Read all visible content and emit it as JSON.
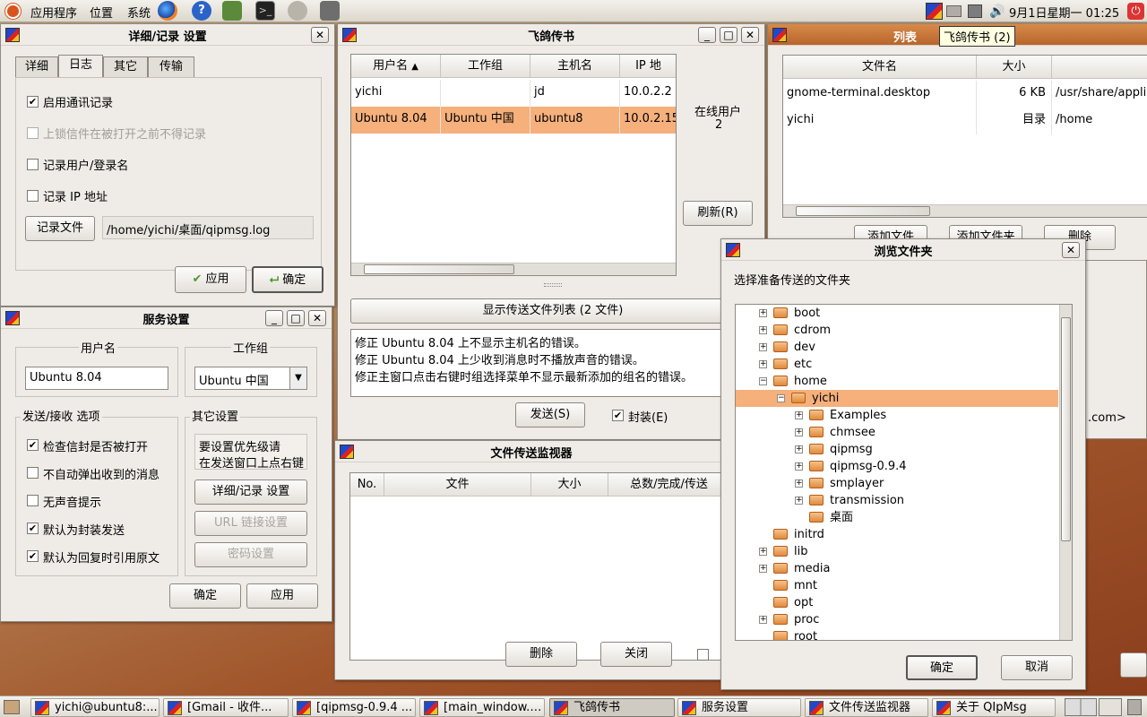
{
  "panel": {
    "menus": [
      "应用程序",
      "位置",
      "系统"
    ],
    "clock": "9月1日星期一 01:25",
    "tooltip": "飞鸽传书 (2)"
  },
  "details_window": {
    "title": "详细/记录 设置",
    "tabs": [
      "详细",
      "日志",
      "其它",
      "传输"
    ],
    "active_tab": "日志",
    "options": [
      {
        "label": "启用通讯记录",
        "checked": true,
        "enabled": true
      },
      {
        "label": "上锁信件在被打开之前不得记录",
        "checked": false,
        "enabled": false
      },
      {
        "label": "记录用户/登录名",
        "checked": false,
        "enabled": true
      },
      {
        "label": "记录 IP 地址",
        "checked": false,
        "enabled": true
      }
    ],
    "log_file_button": "记录文件",
    "log_file_path": "/home/yichi/桌面/qipmsg.log",
    "apply": "应用",
    "ok": "确定"
  },
  "service_window": {
    "title": "服务设置",
    "username_label": "用户名",
    "username_value": "Ubuntu 8.04",
    "workgroup_label": "工作组",
    "workgroup_value": "Ubuntu 中国",
    "send_recv_label": "发送/接收 选项",
    "send_options": [
      {
        "label": "检查信封是否被打开",
        "checked": true
      },
      {
        "label": "不自动弹出收到的消息",
        "checked": false
      },
      {
        "label": "无声音提示",
        "checked": false
      },
      {
        "label": "默认为封装发送",
        "checked": true
      },
      {
        "label": "默认为回复时引用原文",
        "checked": true
      }
    ],
    "other_label": "其它设置",
    "priority_hint": [
      "要设置优先级请",
      "在发送窗口上点右键"
    ],
    "details_button": "详细/记录 设置",
    "url_button": "URL 链接设置",
    "password_button": "密码设置",
    "ok": "确定",
    "apply": "应用"
  },
  "main_window": {
    "title": "飞鸽传书",
    "columns": [
      "用户名",
      "工作组",
      "主机名",
      "IP 地"
    ],
    "rows": [
      {
        "user": "yichi",
        "group": "",
        "host": "jd",
        "ip": "10.0.2.2",
        "selected": false
      },
      {
        "user": "Ubuntu 8.04",
        "group": "Ubuntu 中国",
        "host": "ubuntu8",
        "ip": "10.0.2.15",
        "selected": true
      }
    ],
    "online_label": "在线用户",
    "online_count": "2",
    "refresh": "刷新(R)",
    "show_files": "显示传送文件列表 (2 文件)",
    "message_lines": [
      "修正 Ubuntu 8.04 上不显示主机名的错误。",
      "修正 Ubuntu 8.04 上少收到消息时不播放声音的错误。",
      "修正主窗口点击右键时组选择菜单不显示最新添加的组名的错误。"
    ],
    "send": "发送(S)",
    "seal": "封装(E)",
    "seal_checked": true
  },
  "file_list_window": {
    "title": "列表",
    "columns": [
      "文件名",
      "大小",
      ""
    ],
    "rows": [
      {
        "name": "gnome-terminal.desktop",
        "size": "6 KB",
        "path": "/usr/share/applic"
      },
      {
        "name": "yichi",
        "size": "目录",
        "path": "/home"
      }
    ],
    "add_file": "添加文件",
    "add_folder": "添加文件夹",
    "delete": "删除",
    "partial_text": ".com>"
  },
  "monitor_window": {
    "title": "文件传送监视器",
    "columns": [
      "No.",
      "文件",
      "大小",
      "总数/完成/传送"
    ],
    "delete": "删除",
    "close": "关闭"
  },
  "browse_dialog": {
    "title": "浏览文件夹",
    "prompt": "选择准备传送的文件夹",
    "tree": [
      {
        "name": "boot",
        "level": 0,
        "expander": "+"
      },
      {
        "name": "cdrom",
        "level": 0,
        "expander": "+"
      },
      {
        "name": "dev",
        "level": 0,
        "expander": "+"
      },
      {
        "name": "etc",
        "level": 0,
        "expander": "+"
      },
      {
        "name": "home",
        "level": 0,
        "expander": "-"
      },
      {
        "name": "yichi",
        "level": 1,
        "expander": "-",
        "selected": true
      },
      {
        "name": "Examples",
        "level": 2,
        "expander": "+"
      },
      {
        "name": "chmsee",
        "level": 2,
        "expander": "+"
      },
      {
        "name": "qipmsg",
        "level": 2,
        "expander": "+"
      },
      {
        "name": "qipmsg-0.9.4",
        "level": 2,
        "expander": "+"
      },
      {
        "name": "smplayer",
        "level": 2,
        "expander": "+"
      },
      {
        "name": "transmission",
        "level": 2,
        "expander": "+"
      },
      {
        "name": "桌面",
        "level": 2,
        "expander": ""
      },
      {
        "name": "initrd",
        "level": 0,
        "expander": ""
      },
      {
        "name": "lib",
        "level": 0,
        "expander": "+"
      },
      {
        "name": "media",
        "level": 0,
        "expander": "+"
      },
      {
        "name": "mnt",
        "level": 0,
        "expander": ""
      },
      {
        "name": "opt",
        "level": 0,
        "expander": ""
      },
      {
        "name": "proc",
        "level": 0,
        "expander": "+"
      },
      {
        "name": "root",
        "level": 0,
        "expander": ""
      }
    ],
    "ok": "确定",
    "cancel": "取消"
  },
  "taskbar": [
    {
      "label": "yichi@ubuntu8:...",
      "active": false
    },
    {
      "label": "[Gmail - 收件...",
      "active": false
    },
    {
      "label": "[qipmsg-0.9.4 ...",
      "active": false
    },
    {
      "label": "[main_window.…",
      "active": false
    },
    {
      "label": "飞鸽传书",
      "active": true
    },
    {
      "label": "服务设置",
      "active": false
    },
    {
      "label": "文件传送监视器",
      "active": false
    },
    {
      "label": "关于 QIpMsg",
      "active": false
    }
  ],
  "colors": {
    "selection": "#f5b07c",
    "window_bg": "#efebe7"
  }
}
